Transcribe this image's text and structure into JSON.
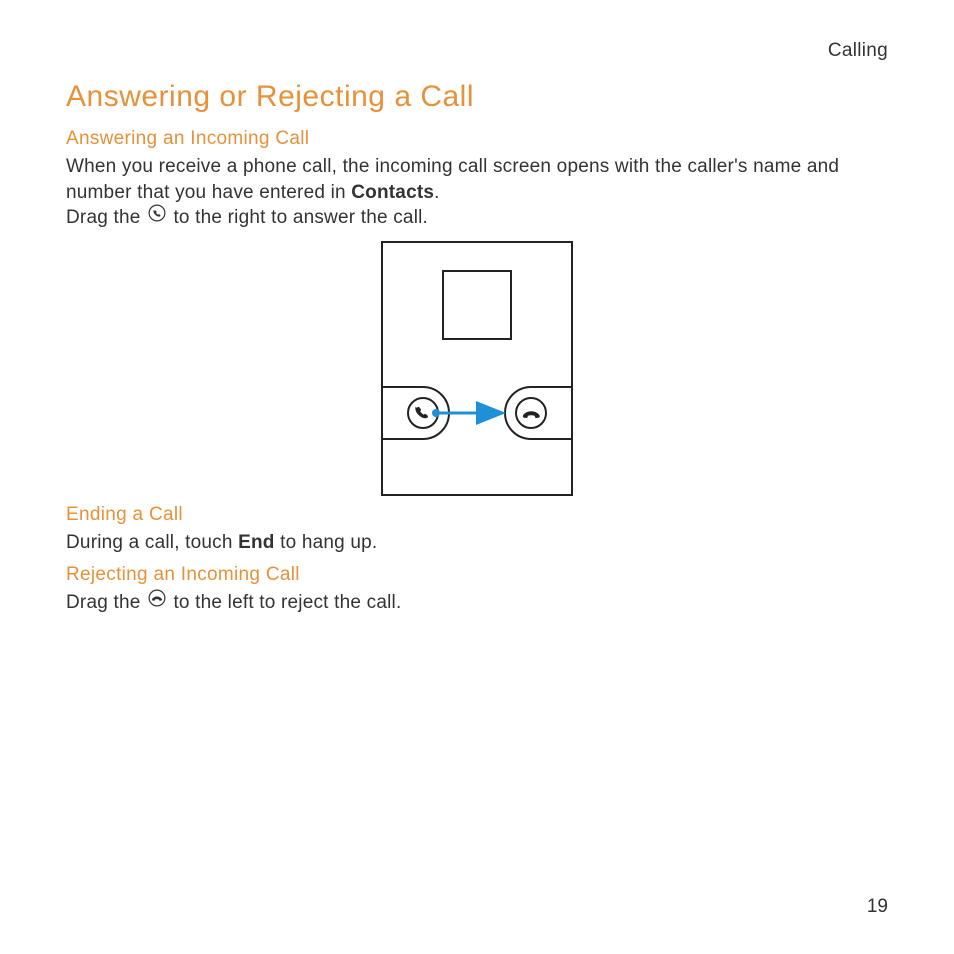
{
  "breadcrumb": "Calling",
  "title": "Answering or Rejecting a Call",
  "section1": {
    "heading": "Answering an Incoming Call",
    "p1_a": "When you receive a phone call, the incoming call screen opens with the caller's name and number that you have entered in ",
    "p1_bold": "Contacts",
    "p1_b": ".",
    "p2_a": "Drag the ",
    "p2_b": " to the right to answer the call."
  },
  "section2": {
    "heading": "Ending a Call",
    "p1_a": "During a call, touch ",
    "p1_bold": "End",
    "p1_b": " to hang up."
  },
  "section3": {
    "heading": "Rejecting an Incoming Call",
    "p1_a": "Drag the ",
    "p1_b": " to the left to reject the call."
  },
  "pageNumber": "19"
}
